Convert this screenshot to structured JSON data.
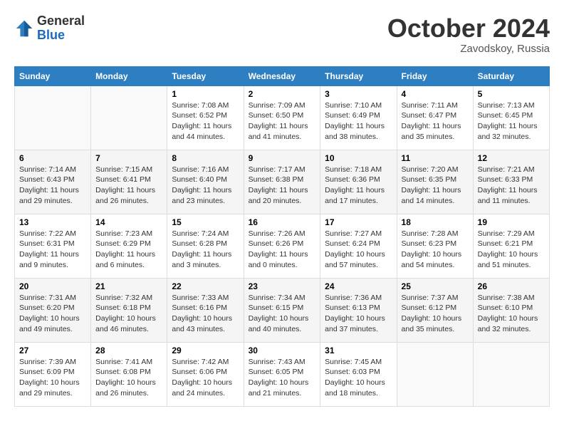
{
  "header": {
    "logo_general": "General",
    "logo_blue": "Blue",
    "month": "October 2024",
    "location": "Zavodskoy, Russia"
  },
  "weekdays": [
    "Sunday",
    "Monday",
    "Tuesday",
    "Wednesday",
    "Thursday",
    "Friday",
    "Saturday"
  ],
  "weeks": [
    [
      {
        "day": "",
        "info": ""
      },
      {
        "day": "",
        "info": ""
      },
      {
        "day": "1",
        "info": "Sunrise: 7:08 AM\nSunset: 6:52 PM\nDaylight: 11 hours and 44 minutes."
      },
      {
        "day": "2",
        "info": "Sunrise: 7:09 AM\nSunset: 6:50 PM\nDaylight: 11 hours and 41 minutes."
      },
      {
        "day": "3",
        "info": "Sunrise: 7:10 AM\nSunset: 6:49 PM\nDaylight: 11 hours and 38 minutes."
      },
      {
        "day": "4",
        "info": "Sunrise: 7:11 AM\nSunset: 6:47 PM\nDaylight: 11 hours and 35 minutes."
      },
      {
        "day": "5",
        "info": "Sunrise: 7:13 AM\nSunset: 6:45 PM\nDaylight: 11 hours and 32 minutes."
      }
    ],
    [
      {
        "day": "6",
        "info": "Sunrise: 7:14 AM\nSunset: 6:43 PM\nDaylight: 11 hours and 29 minutes."
      },
      {
        "day": "7",
        "info": "Sunrise: 7:15 AM\nSunset: 6:41 PM\nDaylight: 11 hours and 26 minutes."
      },
      {
        "day": "8",
        "info": "Sunrise: 7:16 AM\nSunset: 6:40 PM\nDaylight: 11 hours and 23 minutes."
      },
      {
        "day": "9",
        "info": "Sunrise: 7:17 AM\nSunset: 6:38 PM\nDaylight: 11 hours and 20 minutes."
      },
      {
        "day": "10",
        "info": "Sunrise: 7:18 AM\nSunset: 6:36 PM\nDaylight: 11 hours and 17 minutes."
      },
      {
        "day": "11",
        "info": "Sunrise: 7:20 AM\nSunset: 6:35 PM\nDaylight: 11 hours and 14 minutes."
      },
      {
        "day": "12",
        "info": "Sunrise: 7:21 AM\nSunset: 6:33 PM\nDaylight: 11 hours and 11 minutes."
      }
    ],
    [
      {
        "day": "13",
        "info": "Sunrise: 7:22 AM\nSunset: 6:31 PM\nDaylight: 11 hours and 9 minutes."
      },
      {
        "day": "14",
        "info": "Sunrise: 7:23 AM\nSunset: 6:29 PM\nDaylight: 11 hours and 6 minutes."
      },
      {
        "day": "15",
        "info": "Sunrise: 7:24 AM\nSunset: 6:28 PM\nDaylight: 11 hours and 3 minutes."
      },
      {
        "day": "16",
        "info": "Sunrise: 7:26 AM\nSunset: 6:26 PM\nDaylight: 11 hours and 0 minutes."
      },
      {
        "day": "17",
        "info": "Sunrise: 7:27 AM\nSunset: 6:24 PM\nDaylight: 10 hours and 57 minutes."
      },
      {
        "day": "18",
        "info": "Sunrise: 7:28 AM\nSunset: 6:23 PM\nDaylight: 10 hours and 54 minutes."
      },
      {
        "day": "19",
        "info": "Sunrise: 7:29 AM\nSunset: 6:21 PM\nDaylight: 10 hours and 51 minutes."
      }
    ],
    [
      {
        "day": "20",
        "info": "Sunrise: 7:31 AM\nSunset: 6:20 PM\nDaylight: 10 hours and 49 minutes."
      },
      {
        "day": "21",
        "info": "Sunrise: 7:32 AM\nSunset: 6:18 PM\nDaylight: 10 hours and 46 minutes."
      },
      {
        "day": "22",
        "info": "Sunrise: 7:33 AM\nSunset: 6:16 PM\nDaylight: 10 hours and 43 minutes."
      },
      {
        "day": "23",
        "info": "Sunrise: 7:34 AM\nSunset: 6:15 PM\nDaylight: 10 hours and 40 minutes."
      },
      {
        "day": "24",
        "info": "Sunrise: 7:36 AM\nSunset: 6:13 PM\nDaylight: 10 hours and 37 minutes."
      },
      {
        "day": "25",
        "info": "Sunrise: 7:37 AM\nSunset: 6:12 PM\nDaylight: 10 hours and 35 minutes."
      },
      {
        "day": "26",
        "info": "Sunrise: 7:38 AM\nSunset: 6:10 PM\nDaylight: 10 hours and 32 minutes."
      }
    ],
    [
      {
        "day": "27",
        "info": "Sunrise: 7:39 AM\nSunset: 6:09 PM\nDaylight: 10 hours and 29 minutes."
      },
      {
        "day": "28",
        "info": "Sunrise: 7:41 AM\nSunset: 6:08 PM\nDaylight: 10 hours and 26 minutes."
      },
      {
        "day": "29",
        "info": "Sunrise: 7:42 AM\nSunset: 6:06 PM\nDaylight: 10 hours and 24 minutes."
      },
      {
        "day": "30",
        "info": "Sunrise: 7:43 AM\nSunset: 6:05 PM\nDaylight: 10 hours and 21 minutes."
      },
      {
        "day": "31",
        "info": "Sunrise: 7:45 AM\nSunset: 6:03 PM\nDaylight: 10 hours and 18 minutes."
      },
      {
        "day": "",
        "info": ""
      },
      {
        "day": "",
        "info": ""
      }
    ]
  ]
}
